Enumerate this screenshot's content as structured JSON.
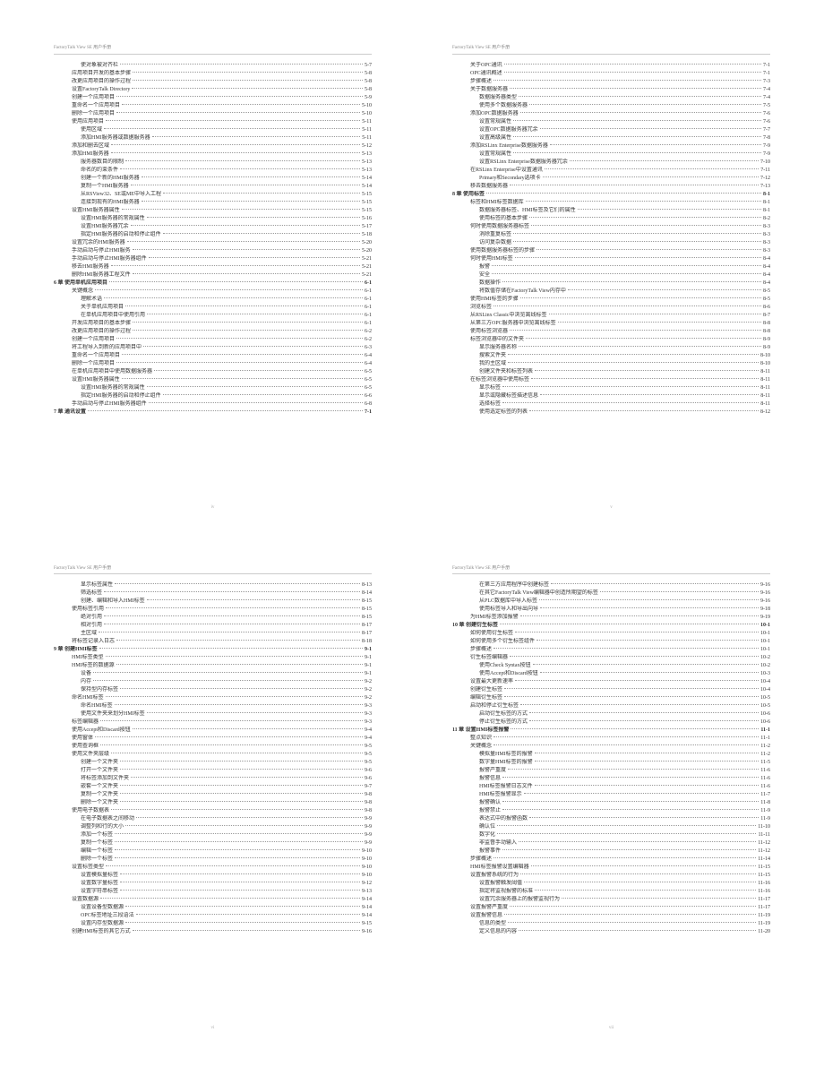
{
  "header": "FactoryTalk View SE 用户手册",
  "pages": [
    {
      "footer": "iv",
      "lines": [
        {
          "indent": 3,
          "label": "使对象被对齐栏",
          "page": "5-7"
        },
        {
          "indent": 2,
          "label": "应用项目开发的基本步骤",
          "page": "5-8"
        },
        {
          "indent": 2,
          "label": "改更应用项目的操作过程",
          "page": "5-8"
        },
        {
          "indent": 2,
          "label": "设置FactoryTalk Directory",
          "page": "5-8"
        },
        {
          "indent": 2,
          "label": "创建一个应用项目",
          "page": "5-9"
        },
        {
          "indent": 2,
          "label": "重命名一个应用项目",
          "page": "5-10"
        },
        {
          "indent": 2,
          "label": "删除一个应用项目",
          "page": "5-10"
        },
        {
          "indent": 2,
          "label": "使用应用项目",
          "page": "5-11"
        },
        {
          "indent": 3,
          "label": "使用区域",
          "page": "5-11"
        },
        {
          "indent": 3,
          "label": "添加HMI服务器或数据服务器",
          "page": "5-11"
        },
        {
          "indent": 2,
          "label": "添加和删去区域",
          "page": "5-12"
        },
        {
          "indent": 2,
          "label": "添加HMI服务器",
          "page": "5-13"
        },
        {
          "indent": 3,
          "label": "服务器数目的限制",
          "page": "5-13"
        },
        {
          "indent": 3,
          "label": "命名的约束条件",
          "page": "5-13"
        },
        {
          "indent": 3,
          "label": "创建一个新的HMI服务器",
          "page": "5-14"
        },
        {
          "indent": 3,
          "label": "复制一个HMI服务器",
          "page": "5-14"
        },
        {
          "indent": 3,
          "label": "从RSView32、SE或ME中导入工程",
          "page": "5-15"
        },
        {
          "indent": 3,
          "label": "连接到现有的HMI服务器",
          "page": "5-15"
        },
        {
          "indent": 2,
          "label": "设置HMI服务器属性",
          "page": "5-15"
        },
        {
          "indent": 3,
          "label": "设置HMI服务器的常规属性",
          "page": "5-16"
        },
        {
          "indent": 3,
          "label": "设置HMI服务器冗余",
          "page": "5-17"
        },
        {
          "indent": 3,
          "label": "指定HMI服务器的启动和停止组件",
          "page": "5-18"
        },
        {
          "indent": 2,
          "label": "设置冗余的HMI服务器",
          "page": "5-20"
        },
        {
          "indent": 2,
          "label": "手动启动与停止HMI服务",
          "page": "5-20"
        },
        {
          "indent": 2,
          "label": "手动启动与停止HMI服务器组件",
          "page": "5-21"
        },
        {
          "indent": 2,
          "label": "移去HMI服务器",
          "page": "5-21"
        },
        {
          "indent": 2,
          "label": "删除HMI服务器工程文件",
          "page": "5-21"
        },
        {
          "indent": 0,
          "label": "6 章  使用单机应用项目",
          "page": "6-1",
          "bold": true
        },
        {
          "indent": 2,
          "label": "关键概念",
          "page": "6-1"
        },
        {
          "indent": 3,
          "label": "理解术语",
          "page": "6-1"
        },
        {
          "indent": 3,
          "label": "关于单机应用项目",
          "page": "6-1"
        },
        {
          "indent": 3,
          "label": "在单机应用项目中使用引用",
          "page": "6-1"
        },
        {
          "indent": 2,
          "label": "开发应用项目的基本步骤",
          "page": "6-1"
        },
        {
          "indent": 2,
          "label": "改更应用项目的操作过程",
          "page": "6-2"
        },
        {
          "indent": 2,
          "label": "创建一个应用项目",
          "page": "6-2"
        },
        {
          "indent": 2,
          "label": "将工程导入到新的应用项目中",
          "page": "6-3"
        },
        {
          "indent": 2,
          "label": "重命名一个应用项目",
          "page": "6-4"
        },
        {
          "indent": 2,
          "label": "删除一个应用项目",
          "page": "6-4"
        },
        {
          "indent": 2,
          "label": "在单机应用项目中使用数据服务器",
          "page": "6-5"
        },
        {
          "indent": 2,
          "label": "设置HMI服务器属性",
          "page": "6-5"
        },
        {
          "indent": 3,
          "label": "设置HMI服务器的常规属性",
          "page": "6-5"
        },
        {
          "indent": 3,
          "label": "指定HMI服务器的启动和停止组件",
          "page": "6-6"
        },
        {
          "indent": 2,
          "label": "手动启动与停止HMI服务器组件",
          "page": "6-8"
        },
        {
          "indent": 0,
          "label": "7 章  通讯设置",
          "page": "7-1",
          "bold": true
        }
      ]
    },
    {
      "footer": "v",
      "lines": [
        {
          "indent": 2,
          "label": "关于OPC通讯",
          "page": "7-1"
        },
        {
          "indent": 2,
          "label": "OPC通讯概述",
          "page": "7-1"
        },
        {
          "indent": 2,
          "label": "步骤概述",
          "page": "7-3"
        },
        {
          "indent": 2,
          "label": "关于数据服务器",
          "page": "7-4"
        },
        {
          "indent": 3,
          "label": "数据服务器类型",
          "page": "7-4"
        },
        {
          "indent": 3,
          "label": "使用多个数据服务器",
          "page": "7-5"
        },
        {
          "indent": 2,
          "label": "添加OPC数据服务器",
          "page": "7-6"
        },
        {
          "indent": 3,
          "label": "设置常规属性",
          "page": "7-6"
        },
        {
          "indent": 3,
          "label": "设置OPC数据服务器冗余",
          "page": "7-7"
        },
        {
          "indent": 3,
          "label": "设置高级属性",
          "page": "7-8"
        },
        {
          "indent": 2,
          "label": "添加RSLinx Enterprise数据服务器",
          "page": "7-9"
        },
        {
          "indent": 3,
          "label": "设置常规属性",
          "page": "7-9"
        },
        {
          "indent": 3,
          "label": "设置RSLinx Enterprise数据服务器冗余",
          "page": "7-10"
        },
        {
          "indent": 2,
          "label": "在RSLinx Enterprise中设置通讯",
          "page": "7-11"
        },
        {
          "indent": 3,
          "label": "Primary和Secondary选项卡",
          "page": "7-12"
        },
        {
          "indent": 2,
          "label": "移去数据服务器",
          "page": "7-13"
        },
        {
          "indent": 0,
          "label": "8 章  使用标签",
          "page": "8-1",
          "bold": true
        },
        {
          "indent": 2,
          "label": "标签和HMI标签数据库",
          "page": "8-1"
        },
        {
          "indent": 3,
          "label": "数据服务器标签、HMI标签及它们的属性",
          "page": "8-1"
        },
        {
          "indent": 3,
          "label": "使用标签的基本步骤",
          "page": "8-2"
        },
        {
          "indent": 2,
          "label": "何时使用数据服务器标签",
          "page": "8-3"
        },
        {
          "indent": 3,
          "label": "消除重复标签",
          "page": "8-3"
        },
        {
          "indent": 3,
          "label": "访问复杂数据",
          "page": "8-3"
        },
        {
          "indent": 2,
          "label": "使用数据服务器标签的步骤",
          "page": "8-3"
        },
        {
          "indent": 2,
          "label": "何时使用HMI标签",
          "page": "8-4"
        },
        {
          "indent": 3,
          "label": "报警",
          "page": "8-4"
        },
        {
          "indent": 3,
          "label": "安全",
          "page": "8-4"
        },
        {
          "indent": 3,
          "label": "数据操作",
          "page": "8-4"
        },
        {
          "indent": 3,
          "label": "将数值存储在FactoryTalk View内存中",
          "page": "8-5"
        },
        {
          "indent": 2,
          "label": "使用HMI标签的步骤",
          "page": "8-5"
        },
        {
          "indent": 2,
          "label": "浏览标签",
          "page": "8-6"
        },
        {
          "indent": 2,
          "label": "从RSLinx Classic中浏览离线标签",
          "page": "8-7"
        },
        {
          "indent": 2,
          "label": "从第三方OPC服务器中浏览离线标签",
          "page": "8-8"
        },
        {
          "indent": 2,
          "label": "使用标签浏览器",
          "page": "8-8"
        },
        {
          "indent": 2,
          "label": "标签浏览器中的文件夹",
          "page": "8-9"
        },
        {
          "indent": 3,
          "label": "显示服务器名称",
          "page": "8-9"
        },
        {
          "indent": 3,
          "label": "搜索文件夹",
          "page": "8-10"
        },
        {
          "indent": 3,
          "label": "我的主区域",
          "page": "8-10"
        },
        {
          "indent": 3,
          "label": "创建文件夹和标签列表",
          "page": "8-11"
        },
        {
          "indent": 2,
          "label": "在标签浏览器中使用标签",
          "page": "8-11"
        },
        {
          "indent": 3,
          "label": "显示标签",
          "page": "8-11"
        },
        {
          "indent": 3,
          "label": "显示或隐藏标签描述信息",
          "page": "8-11"
        },
        {
          "indent": 3,
          "label": "选择标签",
          "page": "8-11"
        },
        {
          "indent": 3,
          "label": "使用选定标签的列表",
          "page": "8-12"
        }
      ]
    },
    {
      "footer": "vi",
      "lines": [
        {
          "indent": 3,
          "label": "显示标签属性",
          "page": "8-13"
        },
        {
          "indent": 3,
          "label": "筛选标签",
          "page": "8-14"
        },
        {
          "indent": 3,
          "label": "创建、编辑和导入HMI标签",
          "page": "8-15"
        },
        {
          "indent": 2,
          "label": "使用标签引用",
          "page": "8-15"
        },
        {
          "indent": 3,
          "label": "绝对引用",
          "page": "8-15"
        },
        {
          "indent": 3,
          "label": "相对引用",
          "page": "8-17"
        },
        {
          "indent": 3,
          "label": "主区域",
          "page": "8-17"
        },
        {
          "indent": 2,
          "label": "将标签记录入日志",
          "page": "8-18"
        },
        {
          "indent": 0,
          "label": "9 章  创建HMI标签",
          "page": "9-1",
          "bold": true
        },
        {
          "indent": 2,
          "label": "HMI标签类型",
          "page": "9-1"
        },
        {
          "indent": 2,
          "label": "HMI标签的数据源",
          "page": "9-1"
        },
        {
          "indent": 3,
          "label": "设备",
          "page": "9-1"
        },
        {
          "indent": 3,
          "label": "内存",
          "page": "9-2"
        },
        {
          "indent": 3,
          "label": "保持型内存标签",
          "page": "9-2"
        },
        {
          "indent": 2,
          "label": "命名HMI标签",
          "page": "9-2"
        },
        {
          "indent": 3,
          "label": "命名HMI标签",
          "page": "9-3"
        },
        {
          "indent": 3,
          "label": "使用文件夹来划分HMI标签",
          "page": "9-3"
        },
        {
          "indent": 2,
          "label": "标签编辑器",
          "page": "9-3"
        },
        {
          "indent": 2,
          "label": "使用Accept和Discard按钮",
          "page": "9-4"
        },
        {
          "indent": 2,
          "label": "使用窗体",
          "page": "9-4"
        },
        {
          "indent": 2,
          "label": "使用查询框",
          "page": "9-5"
        },
        {
          "indent": 2,
          "label": "使用文件夹层级",
          "page": "9-5"
        },
        {
          "indent": 3,
          "label": "创建一个文件夹",
          "page": "9-5"
        },
        {
          "indent": 3,
          "label": "打开一个文件夹",
          "page": "9-6"
        },
        {
          "indent": 3,
          "label": "将标签添加到文件夹",
          "page": "9-6"
        },
        {
          "indent": 3,
          "label": "嵌套一个文件夹",
          "page": "9-7"
        },
        {
          "indent": 3,
          "label": "复制一个文件夹",
          "page": "9-8"
        },
        {
          "indent": 3,
          "label": "删除一个文件夹",
          "page": "9-8"
        },
        {
          "indent": 2,
          "label": "使用电子数据表",
          "page": "9-8"
        },
        {
          "indent": 3,
          "label": "在电子数据表之间移动",
          "page": "9-9"
        },
        {
          "indent": 3,
          "label": "调整列和行的大小",
          "page": "9-9"
        },
        {
          "indent": 3,
          "label": "添加一个标签",
          "page": "9-9"
        },
        {
          "indent": 3,
          "label": "复制一个标签",
          "page": "9-9"
        },
        {
          "indent": 3,
          "label": "编辑一个标签",
          "page": "9-10"
        },
        {
          "indent": 3,
          "label": "删除一个标签",
          "page": "9-10"
        },
        {
          "indent": 2,
          "label": "设置标签类型",
          "page": "9-10"
        },
        {
          "indent": 3,
          "label": "设置模拟量标签",
          "page": "9-10"
        },
        {
          "indent": 3,
          "label": "设置数字量标签",
          "page": "9-12"
        },
        {
          "indent": 3,
          "label": "设置字符串标签",
          "page": "9-13"
        },
        {
          "indent": 2,
          "label": "设置数据源",
          "page": "9-14"
        },
        {
          "indent": 3,
          "label": "设置设备型数据源",
          "page": "9-14"
        },
        {
          "indent": 3,
          "label": "OPC标签地址三段语法",
          "page": "9-14"
        },
        {
          "indent": 3,
          "label": "设置内存型数据源",
          "page": "9-15"
        },
        {
          "indent": 2,
          "label": "创建HMI标签的其它方式",
          "page": "9-16"
        }
      ]
    },
    {
      "footer": "vii",
      "lines": [
        {
          "indent": 3,
          "label": "在第三方应用程序中创建标签",
          "page": "9-16"
        },
        {
          "indent": 3,
          "label": "在其它FactoryTalk View编辑器中创造所期望的标签",
          "page": "9-16"
        },
        {
          "indent": 3,
          "label": "从PLC数据库中导入标签",
          "page": "9-16"
        },
        {
          "indent": 3,
          "label": "使用标签导入和导出向导",
          "page": "9-18"
        },
        {
          "indent": 2,
          "label": "为HMI标签添加报警",
          "page": "9-19"
        },
        {
          "indent": 0,
          "label": "10 章  创建衍生标签",
          "page": "10-1",
          "bold": true
        },
        {
          "indent": 2,
          "label": "如何使用衍生标签",
          "page": "10-1"
        },
        {
          "indent": 2,
          "label": "如何使用多个衍生标签组件",
          "page": "10-1"
        },
        {
          "indent": 2,
          "label": "步骤概述",
          "page": "10-1"
        },
        {
          "indent": 2,
          "label": "衍生标签编辑器",
          "page": "10-2"
        },
        {
          "indent": 3,
          "label": "使用Check Syntax按钮",
          "page": "10-2"
        },
        {
          "indent": 3,
          "label": "使用Accept和Discard按钮",
          "page": "10-3"
        },
        {
          "indent": 2,
          "label": "设置最大更新速率",
          "page": "10-4"
        },
        {
          "indent": 2,
          "label": "创建衍生标签",
          "page": "10-4"
        },
        {
          "indent": 2,
          "label": "编辑衍生标签",
          "page": "10-5"
        },
        {
          "indent": 2,
          "label": "启动和停止衍生标签",
          "page": "10-5"
        },
        {
          "indent": 3,
          "label": "启动衍生标签的方式",
          "page": "10-6"
        },
        {
          "indent": 3,
          "label": "停止衍生标签的方式",
          "page": "10-6"
        },
        {
          "indent": 0,
          "label": "11 章  设置HMI标签报警",
          "page": "11-1",
          "bold": true
        },
        {
          "indent": 2,
          "label": "整点知识",
          "page": "11-1"
        },
        {
          "indent": 2,
          "label": "关键概念",
          "page": "11-2"
        },
        {
          "indent": 3,
          "label": "模拟量HMI标签的报警",
          "page": "11-2"
        },
        {
          "indent": 3,
          "label": "数字量HMI标签的报警",
          "page": "11-5"
        },
        {
          "indent": 3,
          "label": "报警产重度",
          "page": "11-6"
        },
        {
          "indent": 3,
          "label": "报警信息",
          "page": "11-6"
        },
        {
          "indent": 3,
          "label": "HMI标签报警日志文件",
          "page": "11-6"
        },
        {
          "indent": 3,
          "label": "HMI标签报警显示",
          "page": "11-7"
        },
        {
          "indent": 3,
          "label": "报警确认",
          "page": "11-8"
        },
        {
          "indent": 3,
          "label": "报警禁止",
          "page": "11-9"
        },
        {
          "indent": 3,
          "label": "表达式中的报警函数",
          "page": "11-9"
        },
        {
          "indent": 3,
          "label": "确认位",
          "page": "11-10"
        },
        {
          "indent": 3,
          "label": "数字化",
          "page": "11-11"
        },
        {
          "indent": 3,
          "label": "非监督手动输入",
          "page": "11-12"
        },
        {
          "indent": 3,
          "label": "报警事件",
          "page": "11-12"
        },
        {
          "indent": 2,
          "label": "步骤概述",
          "page": "11-14"
        },
        {
          "indent": 2,
          "label": "HMI标签报警设置编辑器",
          "page": "11-15"
        },
        {
          "indent": 2,
          "label": "设置报警系统的行为",
          "page": "11-15"
        },
        {
          "indent": 3,
          "label": "设置报警触发阈值",
          "page": "11-16"
        },
        {
          "indent": 3,
          "label": "指定将监视报警的标准",
          "page": "11-16"
        },
        {
          "indent": 3,
          "label": "设置冗余服务器上的报警监视行为",
          "page": "11-17"
        },
        {
          "indent": 2,
          "label": "设置报警严重度",
          "page": "11-17"
        },
        {
          "indent": 2,
          "label": "设置报警信息",
          "page": "11-19"
        },
        {
          "indent": 3,
          "label": "信息的类型",
          "page": "11-19"
        },
        {
          "indent": 3,
          "label": "定义信息的内容",
          "page": "11-20"
        }
      ]
    }
  ]
}
